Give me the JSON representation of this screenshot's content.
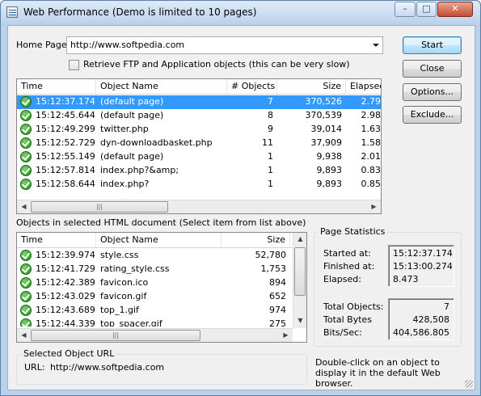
{
  "window": {
    "title": "Web Performance (Demo is limited to 10 pages)",
    "controls": {
      "minimize": "–",
      "maximize": "□",
      "close": "✕"
    }
  },
  "form": {
    "home_page_label": "Home Page",
    "home_page_value": "http://www.softpedia.com",
    "retrieve_checkbox_label": "Retrieve FTP and Application objects (this can be very slow)",
    "retrieve_checked": false
  },
  "buttons": {
    "start": "Start",
    "close": "Close",
    "options": "Options...",
    "exclude": "Exclude..."
  },
  "pages_list": {
    "columns": [
      "Time",
      "Object Name",
      "# Objects",
      "Size",
      "Elapsed"
    ],
    "rows": [
      {
        "time": "15:12:37.174",
        "name": "(default page)",
        "objects": "7",
        "size": "370,526",
        "elapsed": "2.79"
      },
      {
        "time": "15:12:45.644",
        "name": "(default page)",
        "objects": "8",
        "size": "370,539",
        "elapsed": "2.98"
      },
      {
        "time": "15:12:49.299",
        "name": "twitter.php",
        "objects": "9",
        "size": "39,014",
        "elapsed": "1.63"
      },
      {
        "time": "15:12:52.729",
        "name": "dyn-downloadbasket.php",
        "objects": "11",
        "size": "37,909",
        "elapsed": "1.58"
      },
      {
        "time": "15:12:55.149",
        "name": "(default page)",
        "objects": "1",
        "size": "9,938",
        "elapsed": "2.01"
      },
      {
        "time": "15:12:57.814",
        "name": "index.php?&amp;",
        "objects": "1",
        "size": "9,893",
        "elapsed": "0.83"
      },
      {
        "time": "15:12:58.644",
        "name": "index.php?",
        "objects": "1",
        "size": "9,893",
        "elapsed": "0.85"
      }
    ],
    "selected_index": 0
  },
  "objects_section": {
    "label": "Objects in selected HTML document (Select item from list above)",
    "columns": [
      "Time",
      "Object Name",
      "Size"
    ],
    "rows": [
      {
        "time": "15:12:39.974",
        "name": "style.css",
        "size": "52,780"
      },
      {
        "time": "15:12:41.729",
        "name": "rating_style.css",
        "size": "1,753"
      },
      {
        "time": "15:12:42.389",
        "name": "favicon.ico",
        "size": "894"
      },
      {
        "time": "15:12:43.029",
        "name": "favicon.gif",
        "size": "652"
      },
      {
        "time": "15:12:43.689",
        "name": "top_1.gif",
        "size": "974"
      },
      {
        "time": "15:12:44.339",
        "name": "top_spacer.gif",
        "size": "275"
      }
    ]
  },
  "page_statistics": {
    "title": "Page Statistics",
    "started_label": "Started at:",
    "started_value": "15:12:37.174",
    "finished_label": "Finished at:",
    "finished_value": "15:13:00.274",
    "elapsed_label": "Elapsed:",
    "elapsed_value": "8.473",
    "total_objects_label": "Total Objects:",
    "total_objects_value": "7",
    "total_bytes_label": "Total Bytes",
    "total_bytes_value": "428,508",
    "bits_sec_label": "Bits/Sec:",
    "bits_sec_value": "404,586.805"
  },
  "selected_url": {
    "title": "Selected Object URL",
    "label": "URL:",
    "value": "http://www.softpedia.com"
  },
  "hint": {
    "line1": "Double-click on an object to",
    "line2": "display it in the default Web",
    "line3": "browser."
  },
  "scrollbar": {
    "left_arrow": "◀",
    "right_arrow": "▶",
    "up_arrow": "▲",
    "down_arrow": "▼",
    "grip": "|||"
  }
}
